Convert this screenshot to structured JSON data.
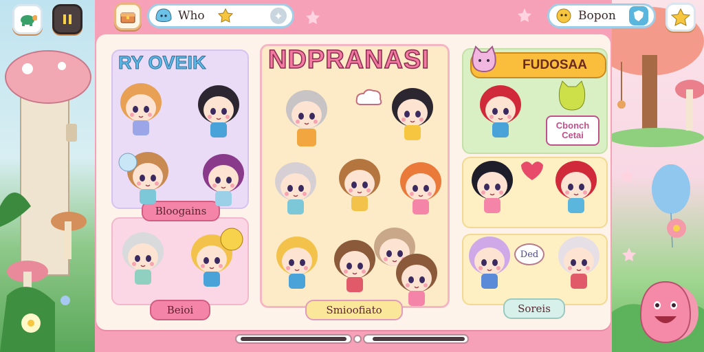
{
  "topbar": {
    "left_search_text": "Who",
    "right_search_text": "Bopon"
  },
  "panels": {
    "left_title": "RY OVEIK",
    "center_title": "NDPRANASI",
    "right_title": "FUDOSAA",
    "right_sign": "Cbonch Cetai"
  },
  "tags": {
    "left_top": "Bloogains",
    "left_bottom": "Beioi",
    "center": "Smioofiato",
    "right": "Soreis"
  },
  "bubble_text": "Ded",
  "colors": {
    "frame_pink": "#f7a1b8",
    "board_cream": "#fdf3ea",
    "left_panel": "#eadcf6",
    "center_panel": "#fdebc8",
    "right_panel": "#fff0c4",
    "tag_pink": "#f585a8",
    "tag_yellow": "#fbe79a",
    "tag_mint": "#d7f1ea"
  },
  "icons": [
    "turtle-icon",
    "pause-icon",
    "treasure-icon",
    "blob-icon",
    "star-icon",
    "add-icon",
    "sun-icon",
    "shield-icon",
    "star-face-icon",
    "cat-icon",
    "cloud-icon",
    "balloon-icon",
    "pink-blob-icon"
  ]
}
